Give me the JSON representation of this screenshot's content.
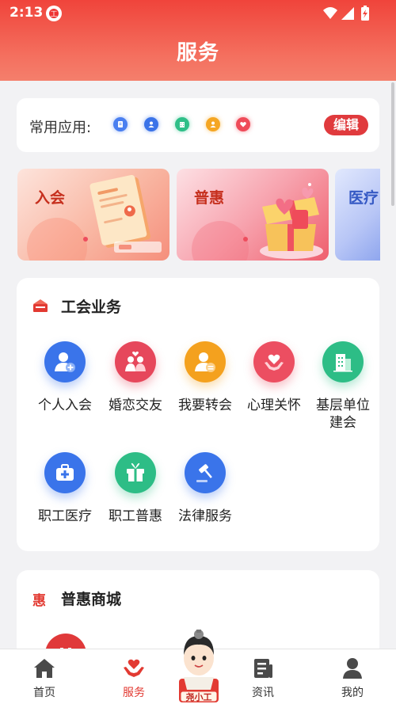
{
  "status_bar": {
    "time": "2:13"
  },
  "header": {
    "title": "服务"
  },
  "common_apps": {
    "label": "常用应用:",
    "edit_label": "编辑",
    "icons": [
      {
        "name": "document-icon",
        "color": "#4a7ff0"
      },
      {
        "name": "user-icon",
        "color": "#3b73e8"
      },
      {
        "name": "building-icon",
        "color": "#2fbf88"
      },
      {
        "name": "user-transfer-icon",
        "color": "#f5a623"
      },
      {
        "name": "heart-icon",
        "color": "#ef4b59"
      }
    ]
  },
  "banners": [
    {
      "label": "入会"
    },
    {
      "label": "普惠"
    },
    {
      "label": "医疗"
    }
  ],
  "union_services": {
    "title": "工会业务",
    "items": [
      {
        "label": "个人入会",
        "icon": "add-user-icon",
        "color": "#3a74ea"
      },
      {
        "label": "婚恋交友",
        "icon": "couple-icon",
        "color": "#e6475b"
      },
      {
        "label": "我要转会",
        "icon": "transfer-user-icon",
        "color": "#f4a11e"
      },
      {
        "label": "心理关怀",
        "icon": "heart-hands-icon",
        "color": "#ec4e61"
      },
      {
        "label": "基层单位建会",
        "icon": "building-icon",
        "color": "#2dbd86"
      },
      {
        "label": "职工医疗",
        "icon": "medical-kit-icon",
        "color": "#3a74ea"
      },
      {
        "label": "职工普惠",
        "icon": "gift-icon",
        "color": "#2dbd86"
      },
      {
        "label": "法律服务",
        "icon": "gavel-icon",
        "color": "#3a74ea"
      }
    ]
  },
  "mall": {
    "icon_text": "惠",
    "title": "普惠商城"
  },
  "bottom_nav": {
    "items": [
      {
        "label": "首页",
        "active": false
      },
      {
        "label": "服务",
        "active": true
      },
      {
        "label": "资讯",
        "active": false
      },
      {
        "label": "我的",
        "active": false
      }
    ],
    "mascot_text": "尧小工"
  }
}
